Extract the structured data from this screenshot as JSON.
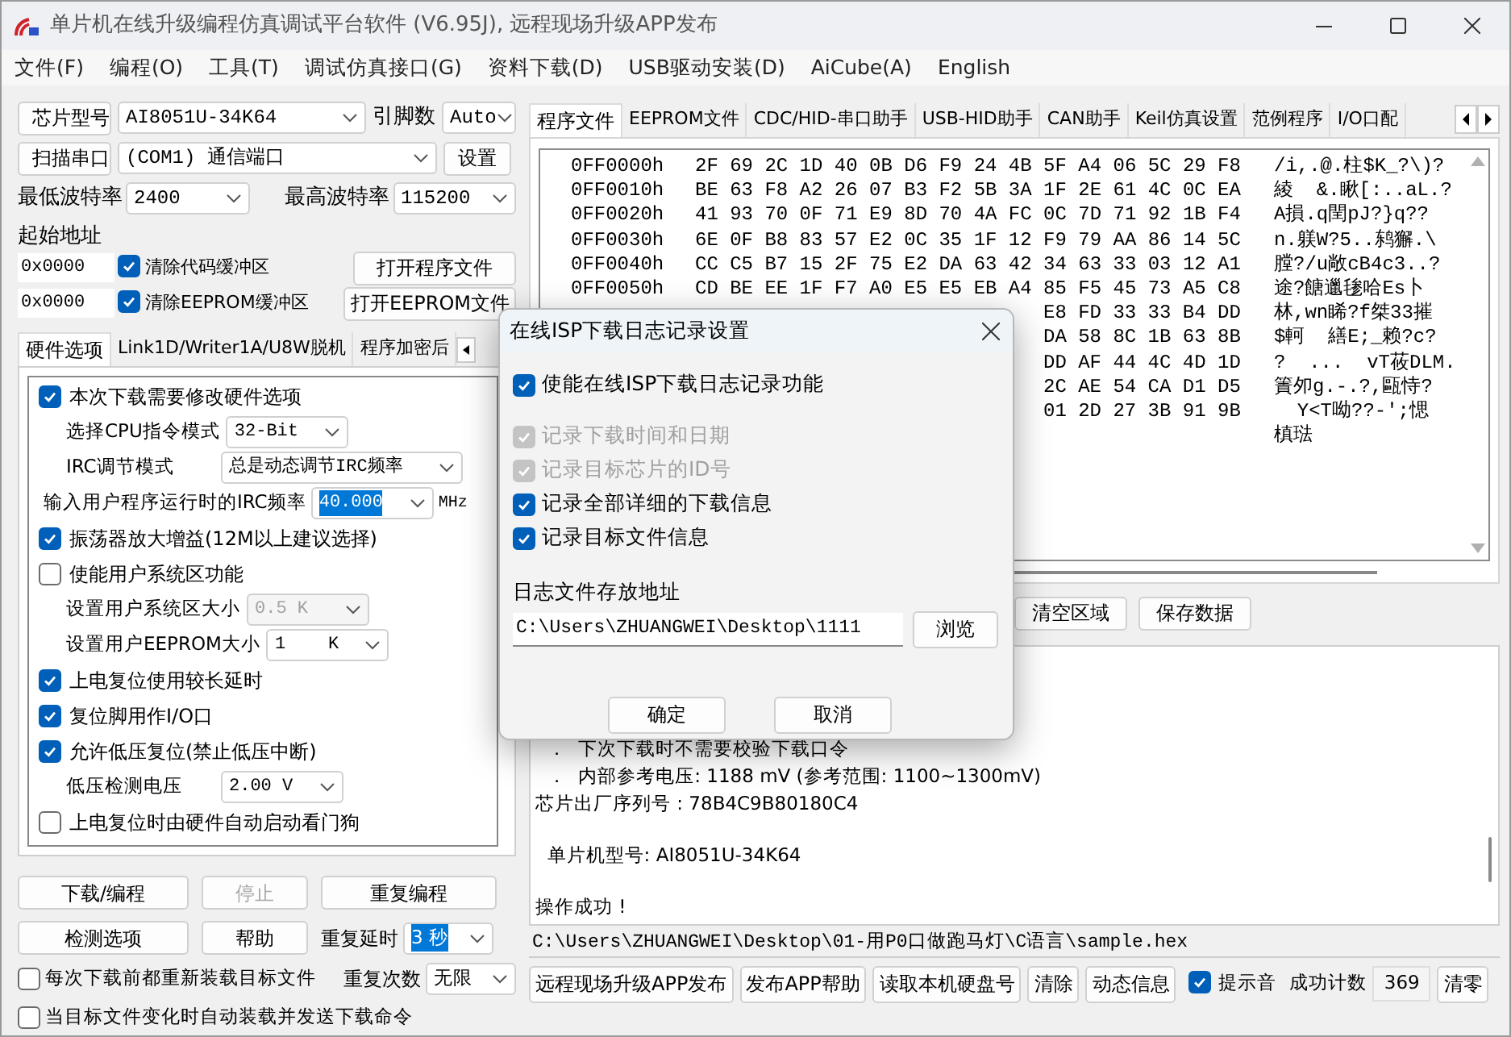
{
  "window": {
    "title": "单片机在线升级编程仿真调试平台软件 (V6.95J), 远程现场升级APP发布"
  },
  "menu": [
    "文件(F)",
    "编程(O)",
    "工具(T)",
    "调试仿真接口(G)",
    "资料下载(D)",
    "USB驱动安装(D)",
    "AiCube(A)",
    "English"
  ],
  "chip": {
    "button": "芯片型号",
    "model": "AI8051U-34K64",
    "pin_label": "引脚数",
    "pins": "Auto"
  },
  "port": {
    "button": "扫描串口",
    "value": "(COM1) 通信端口",
    "settings": "设置"
  },
  "baud": {
    "min_label": "最低波特率",
    "min": "2400",
    "max_label": "最高波特率",
    "max": "115200"
  },
  "start_address": {
    "label": "起始地址",
    "rows": [
      {
        "value": "0x0000",
        "option": "清除代码缓冲区",
        "checked": true,
        "button": "打开程序文件"
      },
      {
        "value": "0x0000",
        "option": "清除EEPROM缓冲区",
        "checked": true,
        "button": "打开EEPROM文件"
      }
    ]
  },
  "option_tabs": [
    {
      "label": "硬件选项",
      "selected": true
    },
    {
      "label": "Link1D/Writer1A/U8W脱机",
      "selected": false
    },
    {
      "label": "程序加密后",
      "selected": false
    }
  ],
  "hardware_options": [
    {
      "kind": "checkbox",
      "label": "本次下载需要修改硬件选项",
      "checked": true
    },
    {
      "kind": "select",
      "label": "选择CPU指令模式",
      "value": "32-Bit",
      "disabled": false
    },
    {
      "kind": "select",
      "label": "IRC调节模式",
      "value": "总是动态调节IRC频率",
      "disabled": false
    },
    {
      "kind": "frequency",
      "label": "输入用户程序运行时的IRC频率",
      "value": "40.000",
      "unit": "MHz"
    },
    {
      "kind": "checkbox",
      "label": "振荡器放大增益(12M以上建议选择)",
      "checked": true
    },
    {
      "kind": "checkbox",
      "label": "使能用户系统区功能",
      "checked": false
    },
    {
      "kind": "select",
      "label": "设置用户系统区大小",
      "value": "0.5 K",
      "disabled": true
    },
    {
      "kind": "select",
      "label": "设置用户EEPROM大小",
      "value": "1    K",
      "disabled": false
    },
    {
      "kind": "checkbox",
      "label": "上电复位使用较长延时",
      "checked": true
    },
    {
      "kind": "checkbox",
      "label": "复位脚用作I/O口",
      "checked": true
    },
    {
      "kind": "checkbox",
      "label": "允许低压复位(禁止低压中断)",
      "checked": true
    },
    {
      "kind": "select",
      "label": "低压检测电压",
      "value": "2.00 V",
      "disabled": false
    },
    {
      "kind": "checkbox",
      "label": "上电复位时由硬件自动启动看门狗",
      "checked": false
    }
  ],
  "actions": [
    {
      "label": "下载/编程",
      "disabled": false
    },
    {
      "label": "停止",
      "disabled": true
    },
    {
      "label": "重复编程",
      "disabled": false
    },
    {
      "label": "检测选项",
      "disabled": false
    },
    {
      "label": "帮助",
      "disabled": false
    }
  ],
  "repeat": {
    "delay_label": "重复延时",
    "delay": "3 秒",
    "count_label": "重复次数",
    "count": "无限"
  },
  "auto_options": [
    {
      "label": "每次下载前都重新装载目标文件",
      "checked": false
    },
    {
      "label": "当目标文件变化时自动装载并发送下载命令",
      "checked": false
    }
  ],
  "file_tabs": [
    {
      "label": "程序文件",
      "selected": true
    },
    {
      "label": "EEPROM文件",
      "selected": false
    },
    {
      "label": "CDC/HID-串口助手",
      "selected": false
    },
    {
      "label": "USB-HID助手",
      "selected": false
    },
    {
      "label": "CAN助手",
      "selected": false
    },
    {
      "label": "Keil仿真设置",
      "selected": false
    },
    {
      "label": "范例程序",
      "selected": false
    },
    {
      "label": "I/O口配",
      "selected": false
    }
  ],
  "hex_rows": [
    {
      "address": "0FF0000h",
      "bytes": "2F 69 2C 1D 40 0B D6 F9 24 4B 5F A4 06 5C 29 F8",
      "ascii": "/i,.@.柱$K_?\\)?"
    },
    {
      "address": "0FF0010h",
      "bytes": "BE 63 F8 A2 26 07 B3 F2 5B 3A 1F 2E 61 4C 0C EA",
      "ascii": "綾  &.瞅[:..aL.?"
    },
    {
      "address": "0FF0020h",
      "bytes": "41 93 70 0F 71 E9 8D 70 4A FC 0C 7D 71 92 1B F4",
      "ascii": "A損.q閏pJ?}q??"
    },
    {
      "address": "0FF0030h",
      "bytes": "6E 0F B8 83 57 E2 0C 35 1F 12 F9 79 AA 86 14 5C",
      "ascii": "n.躾W?5..鸫獬.\\"
    },
    {
      "address": "0FF0040h",
      "bytes": "CC C5 B7 15 2F 75 E2 DA 63 42 34 63 33 03 12 A1",
      "ascii": "膛?/u敞cB4c3..?"
    },
    {
      "address": "0FF0050h",
      "bytes": "CD BE EE 1F F7 A0 E5 E5 EB A4 85 F5 45 73 A5 C8",
      "ascii": "途?餹邋毶哈Es卜"
    },
    {
      "bytes": "E8 FD 33 33 B4 DD",
      "ascii": "林,wn睎?f桀33摧"
    },
    {
      "bytes": "DA 58 8C 1B 63 8B",
      "ascii": "$軻  繕E;_赖?c?"
    },
    {
      "bytes": "DD AF 44 4C 4D 1D",
      "ascii": "?  ...  vT莜DLM."
    },
    {
      "bytes": "2C AE 54 CA D1 D5",
      "ascii": "簀夘g.-.?,甌恃?"
    },
    {
      "bytes": "01 2D 27 3B 91 9B",
      "ascii": "  Y<T呦??-';愢"
    },
    {
      "ascii": "槙琺"
    }
  ],
  "buffer_buttons": [
    "清空区域",
    "保存数据"
  ],
  "log": [
    [
      "  ．  下次下载时不需要校验下载口令",
      "  ．  内部参考电压: 1188 mV (参考范围: 1100~1300mV)",
      "芯片出厂序列号 : 78B4C9B80180C4"
    ],
    [
      "  单片机型号: AI8051U-34K64"
    ],
    [
      "操作成功 !"
    ]
  ],
  "file_path": "C:\\Users\\ZHUANGWEI\\Desktop\\01-用P0口做跑马灯\\C语言\\sample.hex",
  "toolbar": [
    "远程现场升级APP发布",
    "发布APP帮助",
    "读取本机硬盘号",
    "清除",
    "动态信息"
  ],
  "beep": {
    "label": "提示音",
    "checked": true
  },
  "success": {
    "label": "成功计数",
    "value": "369",
    "reset": "清零"
  },
  "dialog": {
    "title": "在线ISP下载日志记录设置",
    "enable": {
      "label": "使能在线ISP下载日志记录功能",
      "checked": true
    },
    "options": [
      {
        "label": "记录下载时间和日期",
        "checked": true,
        "disabled": true
      },
      {
        "label": "记录目标芯片的ID号",
        "checked": true,
        "disabled": true
      },
      {
        "label": "记录全部详细的下载信息",
        "checked": true,
        "disabled": false
      },
      {
        "label": "记录目标文件信息",
        "checked": true,
        "disabled": false
      }
    ],
    "path_label": "日志文件存放地址",
    "path": "C:\\Users\\ZHUANGWEI\\Desktop\\1111",
    "browse": "浏览",
    "ok": "确定",
    "cancel": "取消"
  }
}
